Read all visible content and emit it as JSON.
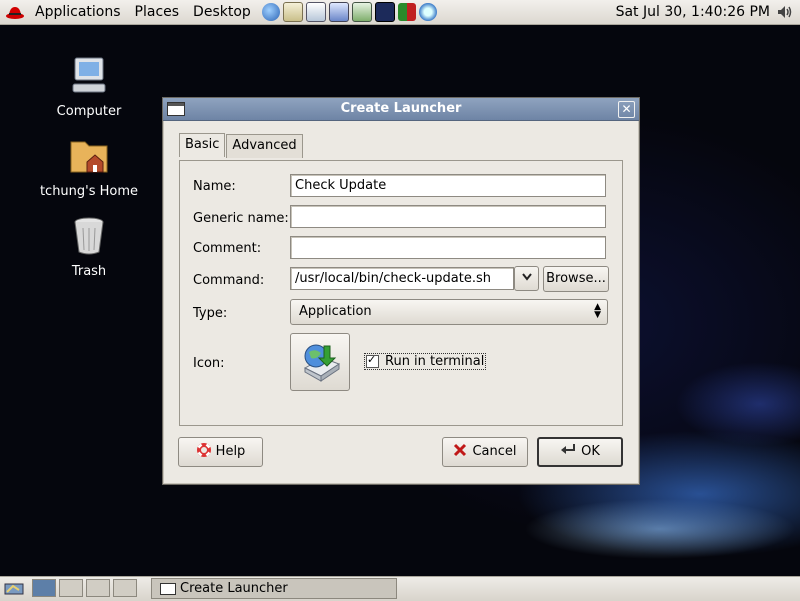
{
  "top_panel": {
    "menus": [
      "Applications",
      "Places",
      "Desktop"
    ],
    "clock": "Sat Jul 30,  1:40:26 PM"
  },
  "desktop": {
    "icons": [
      {
        "label": "Computer"
      },
      {
        "label": "tchung's Home"
      },
      {
        "label": "Trash"
      }
    ]
  },
  "dialog": {
    "title": "Create Launcher",
    "tabs": [
      {
        "label": "Basic",
        "active": true
      },
      {
        "label": "Advanced",
        "active": false
      }
    ],
    "fields": {
      "name_label": "Name:",
      "name_value": "Check Update",
      "generic_label": "Generic name:",
      "generic_value": "",
      "comment_label": "Comment:",
      "comment_value": "",
      "command_label": "Command:",
      "command_value": "/usr/local/bin/check-update.sh",
      "browse_label": "Browse...",
      "type_label": "Type:",
      "type_value": "Application",
      "icon_label": "Icon:",
      "run_in_terminal_label": "Run in terminal",
      "run_in_terminal_checked": true
    },
    "buttons": {
      "help": "Help",
      "cancel": "Cancel",
      "ok": "OK"
    }
  },
  "bottom_panel": {
    "task_label": "Create Launcher"
  }
}
